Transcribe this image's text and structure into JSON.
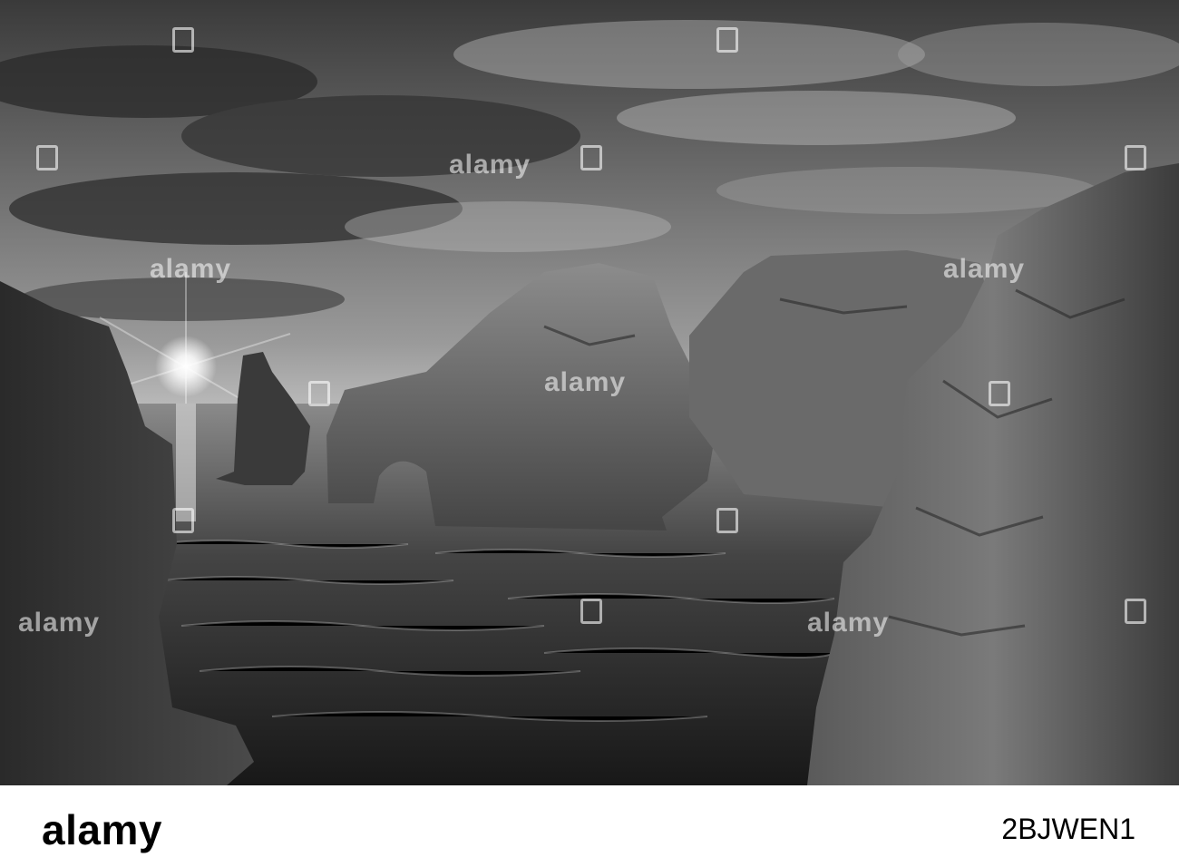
{
  "watermark": {
    "text": "alamy",
    "logo_icon": "alamy-logo-icon"
  },
  "footer": {
    "brand": "alamy",
    "image_id": "2BJWEN1"
  },
  "colors": {
    "background": "#ffffff",
    "photo_tone": "grayscale"
  }
}
